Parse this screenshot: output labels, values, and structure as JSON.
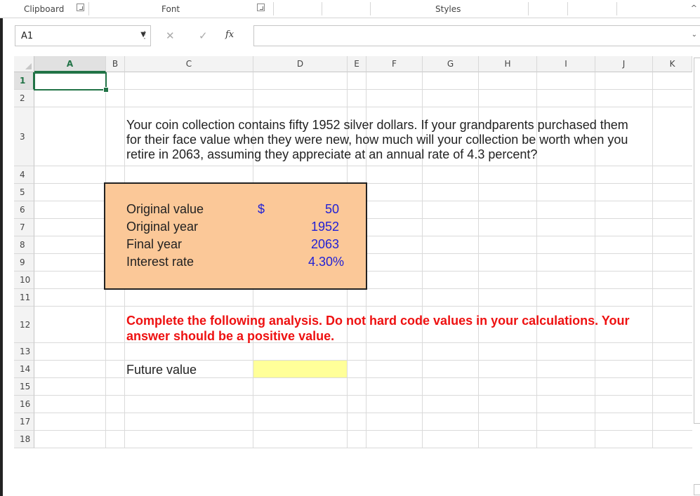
{
  "ribbon": {
    "groups": [
      "Clipboard",
      "Font",
      "Styles"
    ]
  },
  "formula_bar": {
    "name_box": "A1",
    "formula": "",
    "fx_label": "fx"
  },
  "columns": [
    "A",
    "B",
    "C",
    "D",
    "E",
    "F",
    "G",
    "H",
    "I",
    "J",
    "K"
  ],
  "rows": [
    "1",
    "2",
    "3",
    "4",
    "5",
    "6",
    "7",
    "8",
    "9",
    "10",
    "11",
    "12",
    "13",
    "14",
    "15",
    "16",
    "17",
    "18"
  ],
  "selected_cell": "A1",
  "sheet": {
    "question_line1": "Your coin collection contains fifty 1952 silver dollars. If your grandparents purchased them",
    "question_line2": "for their face value when they were new, how much will your collection be worth when you",
    "question_line3": "retire in 2063, assuming they appreciate at an annual rate of 4.3 percent?",
    "inputs": [
      {
        "label": "Original value",
        "currency": "$",
        "value": "50"
      },
      {
        "label": "Original year",
        "currency": "",
        "value": "1952"
      },
      {
        "label": "Final year",
        "currency": "",
        "value": "2063"
      },
      {
        "label": "Interest rate",
        "currency": "",
        "value": "4.30%"
      }
    ],
    "instruction_line1": "Complete the following analysis. Do not hard code values in your calculations. Your",
    "instruction_line2": "answer should be a positive value.",
    "future_value_label": "Future value",
    "future_value": ""
  },
  "colors": {
    "selection": "#217346",
    "input_box": "#fbc898",
    "answer_cell": "#ffff99",
    "input_text": "#1f1fd6",
    "instruction_text": "#ee1111"
  }
}
